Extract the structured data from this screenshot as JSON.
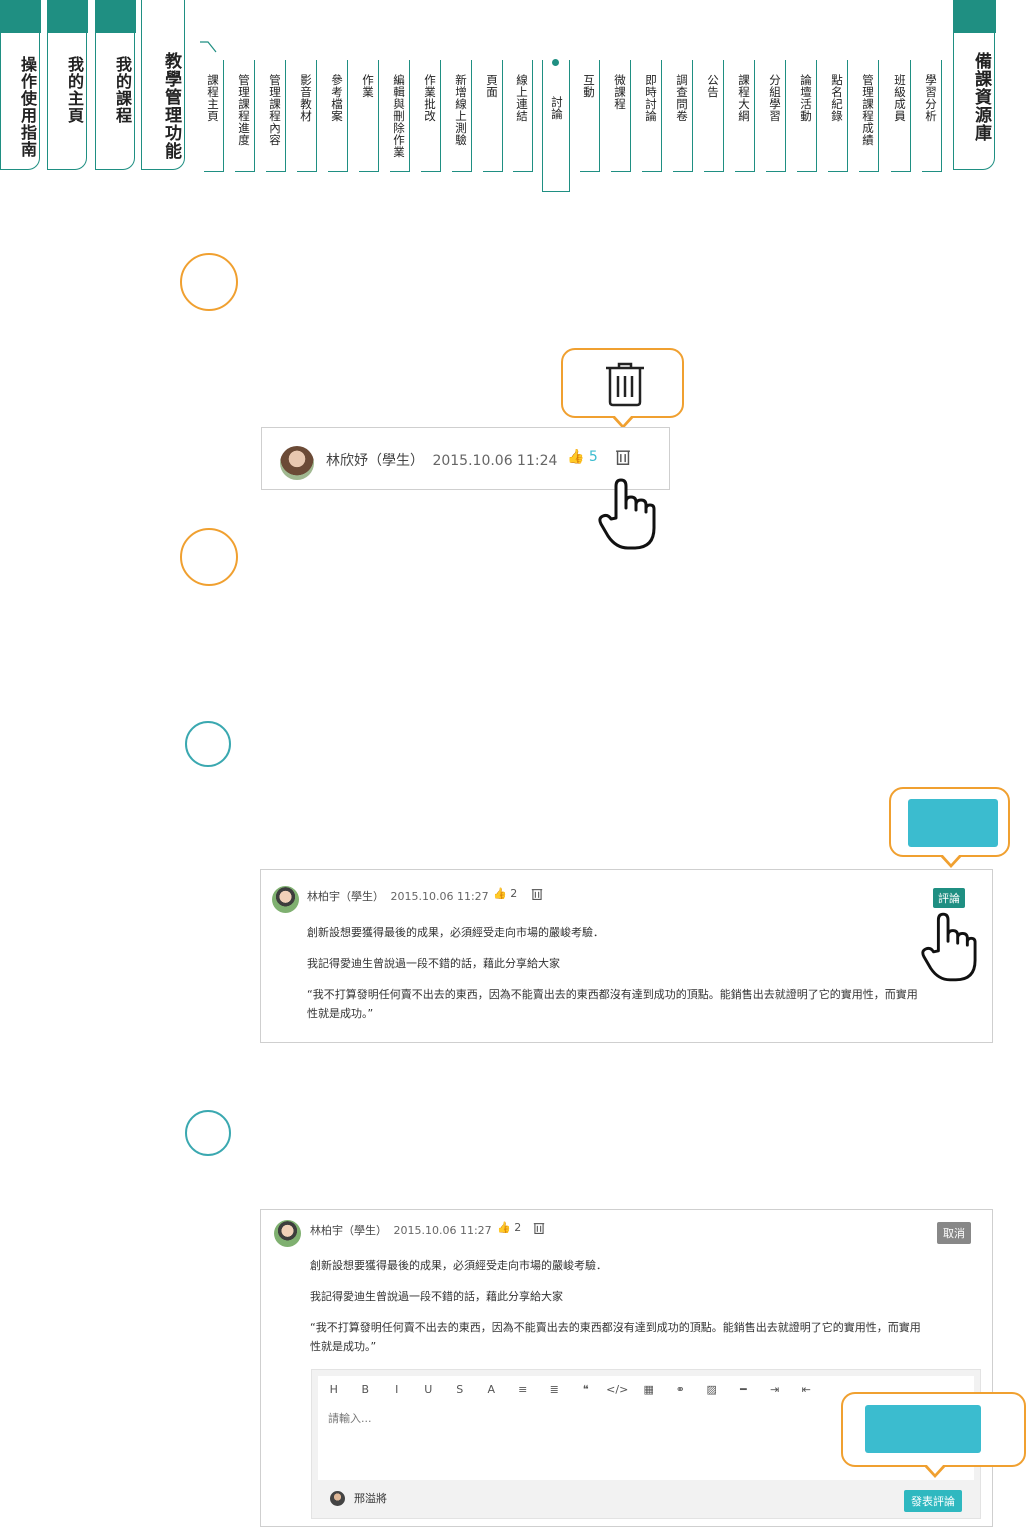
{
  "nav": {
    "main": [
      "操作使用指南",
      "我的主頁",
      "我的課程"
    ],
    "current_main": "教學管理功能",
    "sub": [
      "課程主頁",
      "管理課程進度",
      "管理課程內容",
      "影音教材",
      "參考檔案",
      "作業",
      "編輯與刪除作業",
      "作業批改",
      "新增線上測驗",
      "頁面",
      "線上連結",
      "討論",
      "互動",
      "微課程",
      "即時討論",
      "調查問卷",
      "公告",
      "課程大綱",
      "分組學習",
      "論壇活動",
      "點名紀錄",
      "管理課程成績",
      "班級成員",
      "學習分析"
    ],
    "active_sub": "討論",
    "right": "備課資源庫"
  },
  "comment1": {
    "name": "林欣妤（學生）",
    "time": "2015.10.06 11:24",
    "likes": "5"
  },
  "post": {
    "name": "林柏宇（學生）",
    "time": "2015.10.06 11:27",
    "likes": "2",
    "lines": [
      "創新設想要獲得最後的成果，必須經受走向市場的嚴峻考驗．",
      "我記得愛迪生曾說過一段不錯的話，藉此分享給大家",
      "“我不打算發明任何賣不出去的東西，因為不能賣出去的東西都沒有達到成功的頂點。能銷售出去就證明了它的實用性，而實用",
      "性就是成功。”"
    ],
    "comment_button": "評論"
  },
  "post2": {
    "name": "林柏宇（學生）",
    "time": "2015.10.06 11:27",
    "likes": "2",
    "cancel_button": "取消"
  },
  "editor": {
    "toolbar": [
      "H",
      "B",
      "I",
      "U",
      "S",
      "A",
      "≡",
      "≣",
      "❝",
      "</>",
      "▦",
      "⚭",
      "▨",
      "━",
      "⇥",
      "⇤"
    ],
    "placeholder": "請輸入...",
    "user": "邢溢將",
    "submit_button": "發表評論"
  },
  "colors": {
    "brand_teal": "#1f8f82",
    "accent_orange": "#f0a030",
    "light_teal": "#3bbccf"
  }
}
